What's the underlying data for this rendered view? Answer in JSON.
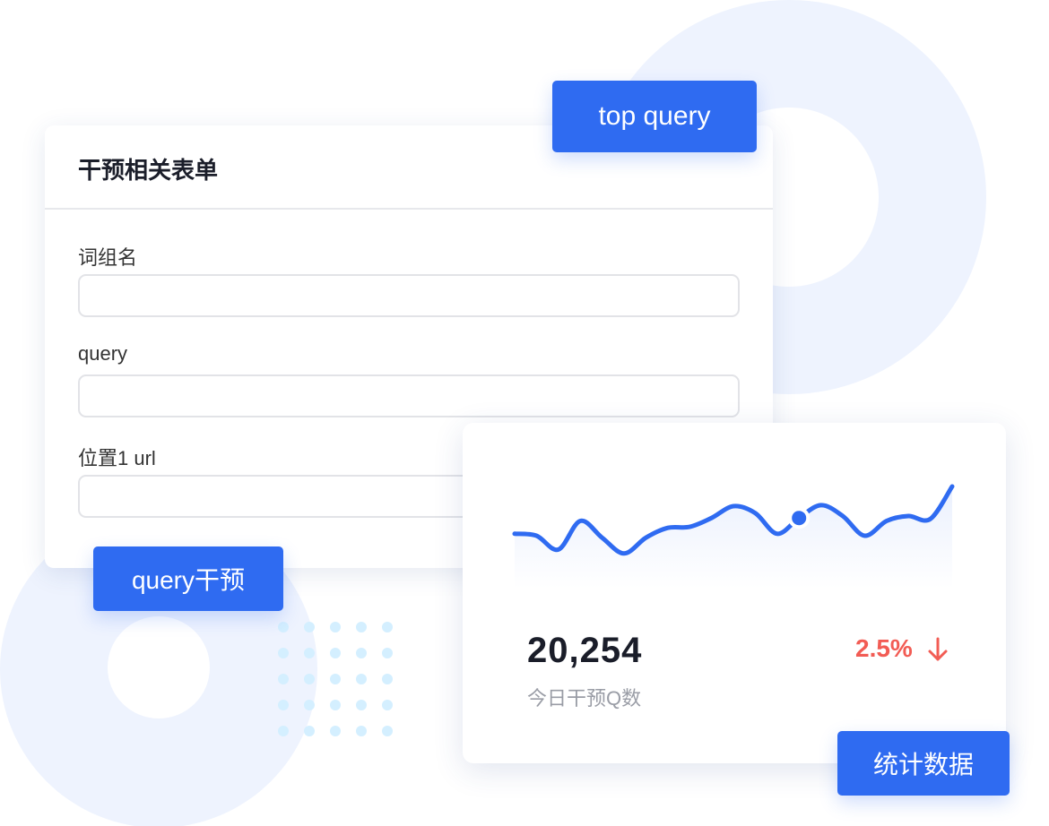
{
  "form": {
    "title": "干预相关表单",
    "fields": [
      {
        "label": "词组名",
        "value": ""
      },
      {
        "label": "query",
        "value": ""
      },
      {
        "label": "位置1 url",
        "value": ""
      }
    ]
  },
  "buttons": {
    "top_query": "top query",
    "query_intervene": "query干预",
    "statistics": "统计数据"
  },
  "stats": {
    "value": "20,254",
    "caption": "今日干预Q数",
    "change": "2.5%",
    "trend": "down",
    "change_color": "#f25c54"
  },
  "chart_data": {
    "type": "line",
    "x": [
      0,
      1,
      2,
      3,
      4,
      5,
      6,
      7,
      8,
      9,
      10,
      11,
      12,
      13,
      14,
      15,
      16,
      17,
      18,
      19,
      20
    ],
    "series": [
      {
        "values": [
          42,
          40,
          26,
          55,
          38,
          22,
          38,
          48,
          49,
          58,
          70,
          63,
          42,
          58,
          71,
          60,
          40,
          55,
          60,
          57,
          90
        ]
      }
    ],
    "highlight_index": 13,
    "grid": false,
    "line_color": "#2f6bf1"
  },
  "colors": {
    "accent": "#2f6bf1",
    "background_ring": "#eef3fe",
    "dot": "#d4efff"
  }
}
